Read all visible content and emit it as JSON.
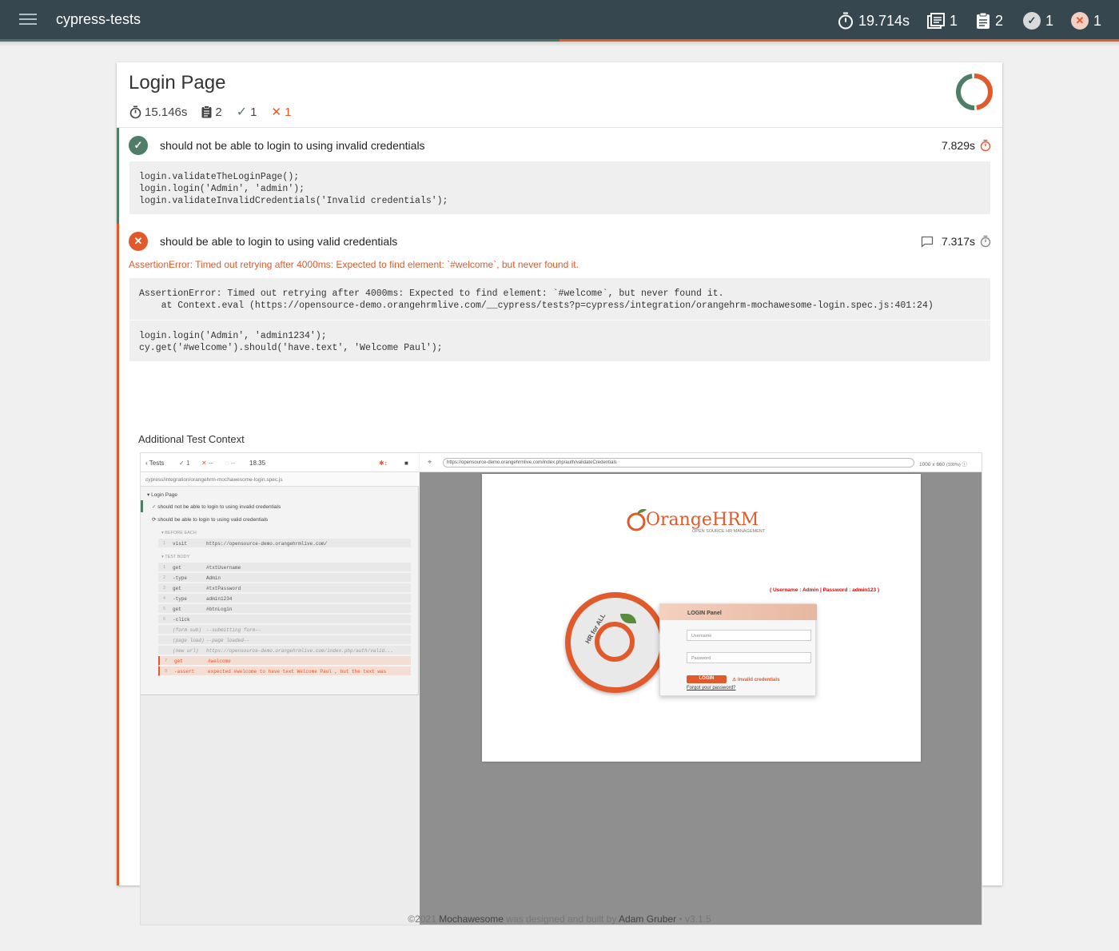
{
  "navbar": {
    "title": "cypress-tests",
    "duration": "19.714s",
    "suites": "1",
    "tests": "2",
    "passes": "1",
    "failures": "1",
    "fail_fraction": 0.5
  },
  "suite": {
    "title": "Login Page",
    "duration": "15.146s",
    "tests": "2",
    "passes": "1",
    "failures": "1",
    "pass_fraction": 0.5
  },
  "tests": [
    {
      "status": "passed",
      "title": "should not be able to login to using invalid credentials",
      "duration": "7.829s",
      "code": "login.validateTheLoginPage();\nlogin.login('Admin', 'admin');\nlogin.validateInvalidCredentials('Invalid credentials');"
    },
    {
      "status": "failed",
      "title": "should be able to login to using valid credentials",
      "duration": "7.317s",
      "error_message": "AssertionError: Timed out retrying after 4000ms: Expected to find element: `#welcome`, but never found it.",
      "stack": "AssertionError: Timed out retrying after 4000ms: Expected to find element: `#welcome`, but never found it.\n    at Context.eval (https://opensource-demo.orangehrmlive.com/__cypress/tests?p=cypress/integration/orangehrm-mochawesome-login.spec.js:401:24)",
      "code": "login.login('Admin', 'admin1234');\ncy.get('#welcome').should('have.text', 'Welcome Paul');",
      "context_title": "Additional Test Context"
    }
  ],
  "screenshot": {
    "toolbar": {
      "tests": "Tests",
      "passed": "1",
      "failed": "--",
      "pending": "--",
      "time": "18.35"
    },
    "spec_path": "cypress/integration/orangehrm-mochawesome-login.spec.js",
    "suite": "Login Page",
    "test1": "should not be able to login to using invalid credentials",
    "test2": "should be able to login to using valid credentials",
    "before_each": "BEFORE EACH",
    "test_body": "TEST BODY",
    "visit_cmd": "visit",
    "visit_arg": "https://opensource-demo.orangehrmlive.com/",
    "commands": [
      {
        "n": "1",
        "c": "get",
        "a": "#txtUsername"
      },
      {
        "n": "2",
        "c": "-type",
        "a": "Admin"
      },
      {
        "n": "3",
        "c": "get",
        "a": "#txtPassword"
      },
      {
        "n": "4",
        "c": "-type",
        "a": "admin1234"
      },
      {
        "n": "5",
        "c": "get",
        "a": "#btnLogin"
      },
      {
        "n": "6",
        "c": "-click",
        "a": ""
      },
      {
        "n": "",
        "c": "(form sub)",
        "a": "--submitting form--"
      },
      {
        "n": "",
        "c": "(page load)",
        "a": "--page loaded--"
      },
      {
        "n": "",
        "c": "(new url)",
        "a": "https://opensource-demo.orangehrmlive.com/index.php/auth/valid..."
      },
      {
        "n": "7",
        "c": "get",
        "a": "#welcome"
      },
      {
        "n": "8",
        "c": "-assert",
        "a": "expected #welcome to have text Welcome Paul , but the text was"
      }
    ],
    "url": "https://opensource-demo.orangehrmlive.com/index.php/auth/validateCredentials",
    "viewport": "1000 x 660",
    "zoom": "(100%)",
    "logo_text": "OrangeHRM",
    "logo_tagline": "OPEN SOURCE HR MANAGEMENT",
    "hint": "( Username : Admin | Password : admin123 )",
    "panel_title": "LOGIN Panel",
    "username_ph": "Username",
    "password_ph": "Password",
    "login_btn": "LOGIN",
    "invalid_msg": "Invalid credentials",
    "forgot": "Forgot your password?",
    "seal_text": "HR for ALL"
  },
  "footer": {
    "prefix": "©2021",
    "product": "Mochawesome",
    "middle": "was designed and built by",
    "author": "Adam Gruber",
    "version": "• v3.1.5"
  },
  "colors": {
    "navbar": "#37474f",
    "pass": "#4e7d68",
    "fail": "#e05a2b"
  }
}
